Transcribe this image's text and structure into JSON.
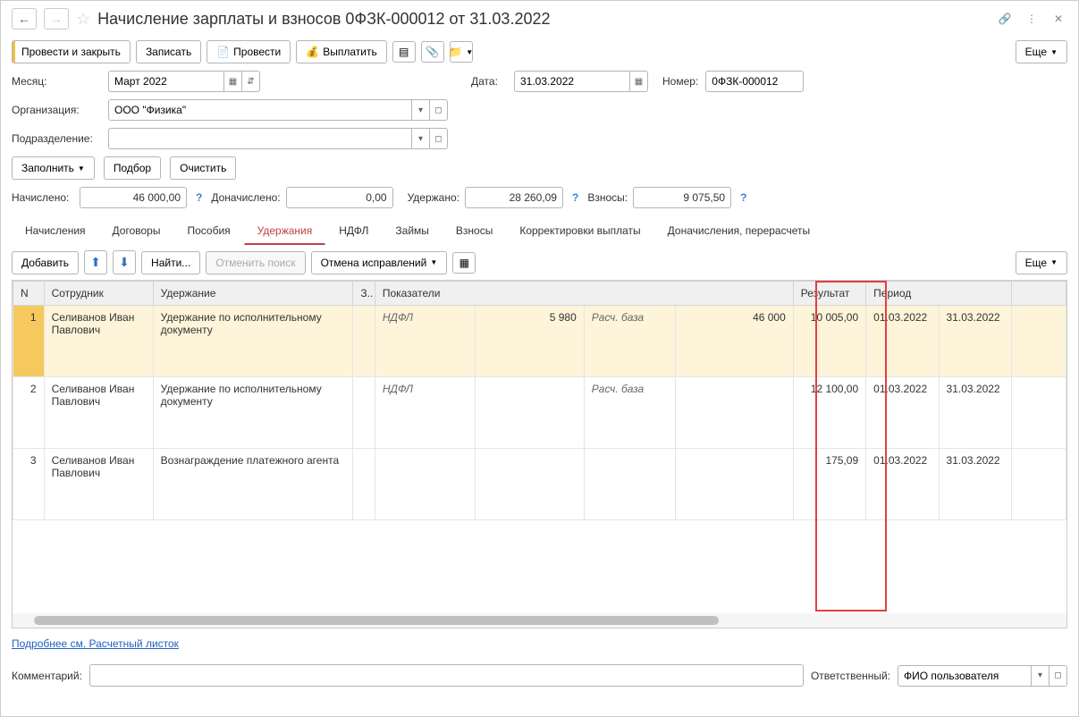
{
  "header": {
    "title": "Начисление зарплаты и взносов 0ФЗК-000012 от 31.03.2022"
  },
  "toolbar": {
    "post_close": "Провести и закрыть",
    "save": "Записать",
    "post": "Провести",
    "pay": "Выплатить",
    "more": "Еще"
  },
  "form": {
    "month_label": "Месяц:",
    "month_value": "Март 2022",
    "date_label": "Дата:",
    "date_value": "31.03.2022",
    "number_label": "Номер:",
    "number_value": "0ФЗК-000012",
    "org_label": "Организация:",
    "org_value": "ООО \"Физика\"",
    "dept_label": "Подразделение:",
    "dept_value": "",
    "fill": "Заполнить",
    "select": "Подбор",
    "clear": "Очистить",
    "accrued_label": "Начислено:",
    "accrued_value": "46 000,00",
    "addaccrued_label": "Доначислено:",
    "addaccrued_value": "0,00",
    "withheld_label": "Удержано:",
    "withheld_value": "28 260,09",
    "contrib_label": "Взносы:",
    "contrib_value": "9 075,50"
  },
  "tabs": {
    "t0": "Начисления",
    "t1": "Договоры",
    "t2": "Пособия",
    "t3": "Удержания",
    "t4": "НДФЛ",
    "t5": "Займы",
    "t6": "Взносы",
    "t7": "Корректировки выплаты",
    "t8": "Доначисления, перерасчеты"
  },
  "tabtoolbar": {
    "add": "Добавить",
    "find": "Найти...",
    "cancel_search": "Отменить поиск",
    "cancel_fixes": "Отмена исправлений",
    "more": "Еще"
  },
  "columns": {
    "n": "N",
    "emp": "Сотрудник",
    "ded": "Удержание",
    "c3": "З..",
    "ind": "Показатели",
    "res": "Результат",
    "period": "Период"
  },
  "rows": [
    {
      "n": "1",
      "emp": "Селиванов Иван Павлович",
      "ded": "Удержание по исполнительному документу",
      "ind1": "НДФЛ",
      "ind1v": "5 980",
      "ind2": "Расч. база",
      "ind2v": "46 000",
      "res": "10 005,00",
      "p1": "01.03.2022",
      "p2": "31.03.2022"
    },
    {
      "n": "2",
      "emp": "Селиванов Иван Павлович",
      "ded": "Удержание по исполнительному документу",
      "ind1": "НДФЛ",
      "ind1v": "",
      "ind2": "Расч. база",
      "ind2v": "",
      "res": "12 100,00",
      "p1": "01.03.2022",
      "p2": "31.03.2022"
    },
    {
      "n": "3",
      "emp": "Селиванов Иван Павлович",
      "ded": "Вознаграждение платежного агента",
      "ind1": "",
      "ind1v": "",
      "ind2": "",
      "ind2v": "",
      "res": "175,09",
      "p1": "01.03.2022",
      "p2": "31.03.2022"
    }
  ],
  "link": "Подробнее см. Расчетный листок",
  "footer": {
    "comment_label": "Комментарий:",
    "comment_value": "",
    "resp_label": "Ответственный:",
    "resp_value": "ФИО пользователя"
  }
}
